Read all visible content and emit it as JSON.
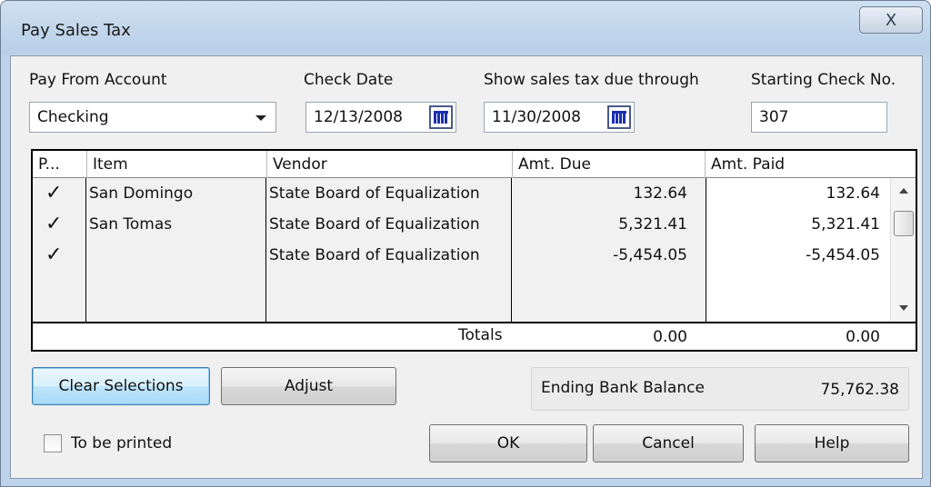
{
  "window": {
    "title": "Pay Sales Tax",
    "close_symbol": "X"
  },
  "pay_from": {
    "label": "Pay From Account",
    "value": "Checking"
  },
  "check_date": {
    "label": "Check Date",
    "value": "12/13/2008"
  },
  "show_through": {
    "label": "Show sales tax due through",
    "value": "11/30/2008"
  },
  "starting_check": {
    "label": "Starting Check No.",
    "value": "307"
  },
  "table": {
    "columns": [
      "P...",
      "Item",
      "Vendor",
      "Amt. Due",
      "Amt. Paid"
    ],
    "rows": [
      {
        "check": "✓",
        "item": "San Domingo",
        "vendor": "State Board of Equalization",
        "amt_due": "132.64",
        "amt_paid": "132.64"
      },
      {
        "check": "✓",
        "item": "San Tomas",
        "vendor": "State Board of Equalization",
        "amt_due": "5,321.41",
        "amt_paid": "5,321.41"
      },
      {
        "check": "✓",
        "item": "",
        "vendor": "State Board of Equalization",
        "amt_due": "-5,454.05",
        "amt_paid": "-5,454.05"
      }
    ],
    "totals_label": "Totals",
    "total_due": "0.00",
    "total_paid": "0.00"
  },
  "buttons": {
    "clear_selections": "Clear Selections",
    "adjust": "Adjust",
    "ok": "OK",
    "cancel": "Cancel",
    "help": "Help"
  },
  "balance": {
    "label": "Ending Bank Balance",
    "value": "75,762.38"
  },
  "to_be_printed": {
    "label": "To be printed",
    "checked": false
  }
}
